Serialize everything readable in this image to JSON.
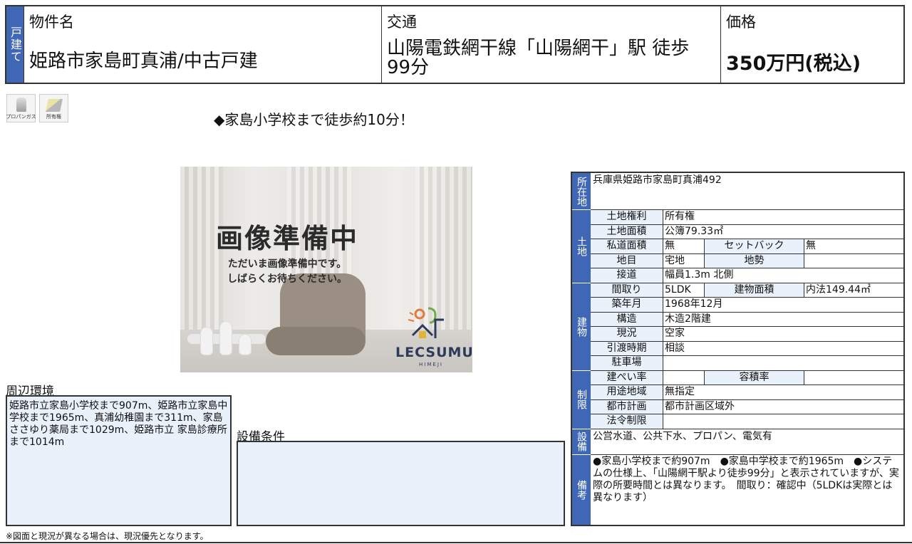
{
  "header": {
    "type_badge": "戸建て",
    "name_label": "物件名",
    "name_value": "姫路市家島町真浦/中古戸建",
    "access_label": "交通",
    "access_value": "山陽電鉄網干線「山陽網干」駅 徒歩99分",
    "price_label": "価格",
    "price_value": "350万円(税込)"
  },
  "icons": [
    {
      "label": "プロパンガス",
      "icon": "propane-gas-icon"
    },
    {
      "label": "所有権",
      "icon": "ownership-icon"
    }
  ],
  "catch_copy": "◆家島小学校まで徒歩約10分！",
  "photo": {
    "title": "画像準備中",
    "message1": "ただいま画像準備中です。",
    "message2": "しばらくお待ちください。",
    "logo_text": "LECSUMU",
    "logo_sub": "HIMEJI"
  },
  "surroundings": {
    "label": "周辺環境",
    "text": "姫路市立家島小学校まで907m、姫路市立家島中学校まで1965m、真浦幼稚園まで311m、家島ささゆり薬局まで1029m、姫路市立 家島診療所まで1014m"
  },
  "equipment_condition": {
    "label": "設備条件",
    "text": ""
  },
  "footnote": "※図面と現況が異なる場合は、現況優先となります。",
  "spec": {
    "location_head": "所在地",
    "location": "兵庫県姫路市家島町真浦492",
    "land_head": "土地",
    "land_right_label": "土地権利",
    "land_right": "所有権",
    "land_area_label": "土地面積",
    "land_area": "公簿79.33㎡",
    "private_road_label": "私道面積",
    "private_road": "無",
    "setback_label": "セットバック",
    "setback": "無",
    "land_category_label": "地目",
    "land_category": "宅地",
    "terrain_label": "地勢",
    "terrain": "",
    "road_access_label": "接道",
    "road_access": "幅員1.3m 北側",
    "building_head": "建物",
    "layout_label": "間取り",
    "layout": "5LDK",
    "building_area_label": "建物面積",
    "building_area": "内法149.44㎡",
    "built_label": "築年月",
    "built": "1968年12月",
    "structure_label": "構造",
    "structure": "木造2階建",
    "status_label": "現況",
    "status": "空家",
    "handover_label": "引渡時期",
    "handover": "相談",
    "parking_label": "駐車場",
    "parking": "",
    "restriction_head": "制限",
    "coverage_label": "建ぺい率",
    "coverage": "",
    "far_label": "容積率",
    "far": "",
    "zoning_label": "用途地域",
    "zoning": "無指定",
    "city_plan_label": "都市計画",
    "city_plan": "都市計画区域外",
    "legal_label": "法令制限",
    "legal": "",
    "facility_head": "設備",
    "facility": "公営水道、公共下水、プロパン、電気有",
    "remarks_head": "備考",
    "remarks": "●家島小学校まで約907m　●家島中学校まで約1965m　●システムの仕様上、「山陽網干駅より徒歩99分」と表示されていますが、実際の所要時間とは異なります。　間取り：確認中（5LDKは実際とは異なります）"
  }
}
